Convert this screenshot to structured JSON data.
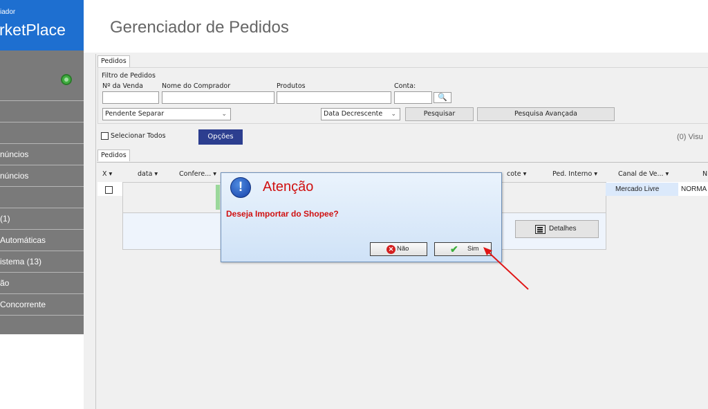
{
  "sidebar": {
    "brand_sub": "iador",
    "brand_title": "rketPlace",
    "items": [
      {
        "label": ""
      },
      {
        "label": ""
      },
      {
        "label": "núncios"
      },
      {
        "label": "núncios"
      },
      {
        "label": ""
      },
      {
        "label": "(1)"
      },
      {
        "label": "Automáticas"
      },
      {
        "label": "istema (13)"
      },
      {
        "label": "ão"
      },
      {
        "label": "Concorrente"
      }
    ]
  },
  "header": {
    "title": "Gerenciador de Pedidos"
  },
  "tabs": {
    "top": "Pedidos",
    "grid": "Pedidos"
  },
  "filter": {
    "legend": "Filtro de Pedidos",
    "labels": {
      "venda": "Nº da Venda",
      "comprador": "Nome do Comprador",
      "produtos": "Produtos",
      "conta": "Conta:"
    },
    "status_select": "Pendente Separar",
    "order_select": "Data Decrescente",
    "search_button": "Pesquisar",
    "advanced_button": "Pesquisa Avançada"
  },
  "toolbar": {
    "select_all": "Selecionar Todos",
    "options_button": "Opções",
    "count": "(0) Visu"
  },
  "grid": {
    "columns": [
      "X ▾",
      "data ▾",
      "Confere... ▾",
      "cote ▾",
      "Ped. Interno ▾",
      "Canal de Ve... ▾",
      "N"
    ],
    "row": {
      "canal": "Mercado Livre",
      "tipo": "NORMA"
    },
    "details_button": "Detalhes"
  },
  "dialog": {
    "title": "Atenção",
    "icon_text": "!",
    "message": "Deseja Importar do Shopee?",
    "no_button": "Não",
    "yes_button": "Sim"
  },
  "colors": {
    "brand": "#1e6fd0",
    "sidebar": "#7a7a7a",
    "dialog_text": "#d01010",
    "options_button": "#2c3e8f",
    "arrow": "#e01515"
  }
}
